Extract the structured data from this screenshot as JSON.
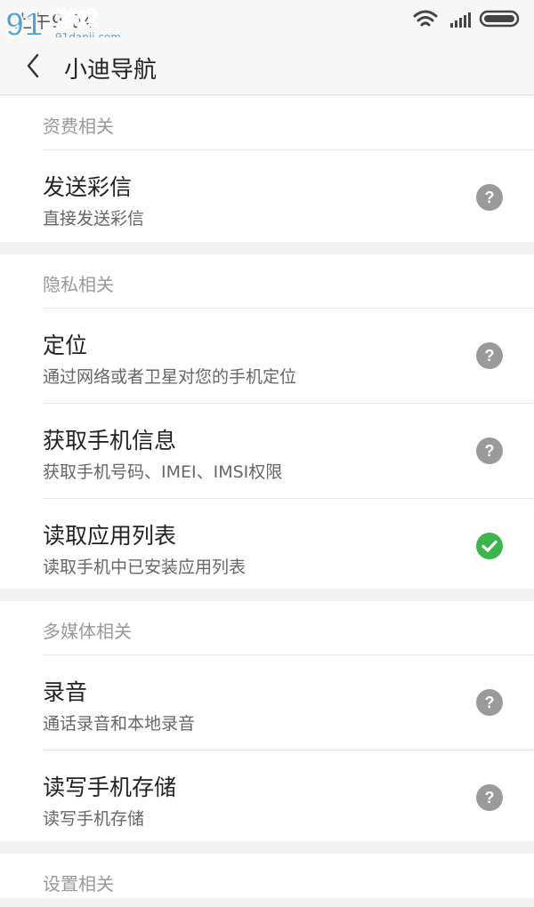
{
  "status_bar": {
    "time": "上午9:04",
    "watermark_brand": "游戏",
    "watermark_url": "91danji.com"
  },
  "app_bar": {
    "title": "小迪导航"
  },
  "sections": [
    {
      "header": "资费相关",
      "items": [
        {
          "title": "发送彩信",
          "subtitle": "直接发送彩信",
          "status": "help-icon"
        }
      ]
    },
    {
      "header": "隐私相关",
      "items": [
        {
          "title": "定位",
          "subtitle": "通过网络或者卫星对您的手机定位",
          "status": "help-icon"
        },
        {
          "title": "获取手机信息",
          "subtitle": "获取手机号码、IMEI、IMSI权限",
          "status": "help-icon"
        },
        {
          "title": "读取应用列表",
          "subtitle": "读取手机中已安装应用列表",
          "status": "check-icon"
        }
      ]
    },
    {
      "header": "多媒体相关",
      "items": [
        {
          "title": "录音",
          "subtitle": "通话录音和本地录音",
          "status": "help-icon"
        },
        {
          "title": "读写手机存储",
          "subtitle": "读写手机存储",
          "status": "help-icon"
        }
      ]
    },
    {
      "header": "设置相关",
      "items": []
    }
  ],
  "colors": {
    "help": "#9a9a9a",
    "check": "#3cb54a",
    "background": "#f2f2f2"
  }
}
